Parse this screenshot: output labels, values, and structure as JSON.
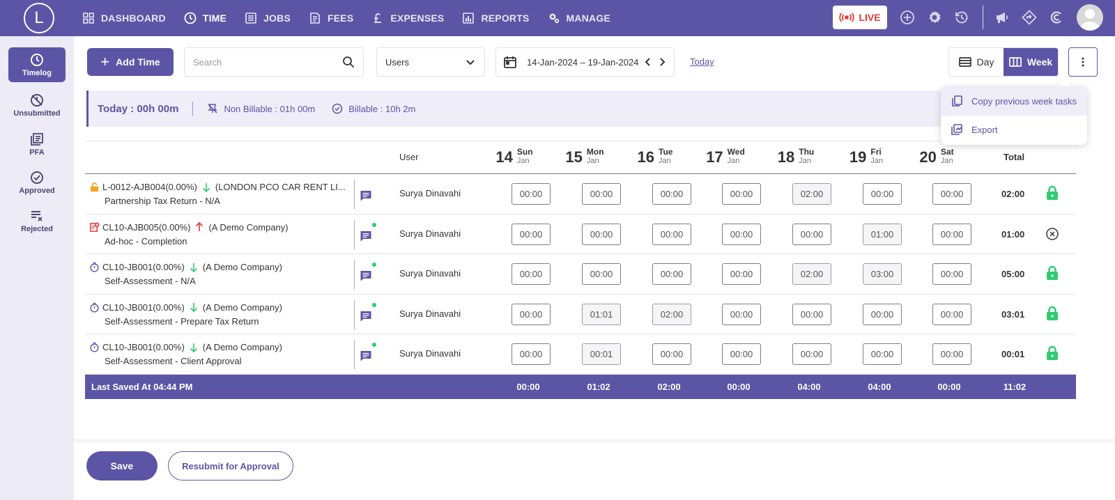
{
  "app": {
    "logo_letter": "L"
  },
  "nav": [
    {
      "label": "DASHBOARD",
      "icon": "grid-icon"
    },
    {
      "label": "TIME",
      "icon": "clock-icon"
    },
    {
      "label": "JOBS",
      "icon": "list-icon"
    },
    {
      "label": "FEES",
      "icon": "document-icon"
    },
    {
      "label": "EXPENSES",
      "icon": "pound-icon"
    },
    {
      "label": "REPORTS",
      "icon": "chart-icon"
    },
    {
      "label": "MANAGE",
      "icon": "gears-icon"
    }
  ],
  "top_actions": {
    "live_label": "LIVE"
  },
  "sidebar": [
    {
      "label": "Timelog",
      "icon": "clock-icon"
    },
    {
      "label": "Unsubmitted",
      "icon": "unsubmitted-icon"
    },
    {
      "label": "PFA",
      "icon": "stack-icon"
    },
    {
      "label": "Approved",
      "icon": "check-circle-icon"
    },
    {
      "label": "Rejected",
      "icon": "reject-list-icon"
    }
  ],
  "toolbar": {
    "add_time_label": "Add Time",
    "search_placeholder": "Search",
    "users_select": "Users",
    "date_range": "14-Jan-2024  –  19-Jan-2024",
    "today_link": "Today",
    "view_day": "Day",
    "view_week": "Week"
  },
  "summary": {
    "today": "Today : 00h 00m",
    "non_billable": "Non Billable : 01h 00m",
    "billable": "Billable : 10h 2m"
  },
  "menu": {
    "copy_label": "Copy previous week tasks",
    "export_label": "Export"
  },
  "table": {
    "user_header": "User",
    "total_header": "Total",
    "days": [
      {
        "num": "14",
        "name": "Sun",
        "month": "Jan"
      },
      {
        "num": "15",
        "name": "Mon",
        "month": "Jan"
      },
      {
        "num": "16",
        "name": "Tue",
        "month": "Jan"
      },
      {
        "num": "17",
        "name": "Wed",
        "month": "Jan"
      },
      {
        "num": "18",
        "name": "Thu",
        "month": "Jan"
      },
      {
        "num": "19",
        "name": "Fri",
        "month": "Jan"
      },
      {
        "num": "20",
        "name": "Sat",
        "month": "Jan"
      }
    ],
    "rows": [
      {
        "code": "L-0012-AJB004(0.00%)",
        "direction": "down",
        "company": "(LONDON PCO CAR RENT LI...",
        "task": "Partnership Tax Return - N/A",
        "user": "Surya Dinavahi",
        "times": [
          "00:00",
          "00:00",
          "00:00",
          "00:00",
          "02:00",
          "00:00",
          "00:00"
        ],
        "total": "02:00",
        "status": "locked",
        "row_icon": "lock-open-icon"
      },
      {
        "code": "CL10-AJB005(0.00%)",
        "direction": "up",
        "company": "(A Demo Company)",
        "task": "Ad-hoc - Completion",
        "user": "Surya Dinavahi",
        "times": [
          "00:00",
          "00:00",
          "00:00",
          "00:00",
          "00:00",
          "01:00",
          "00:00"
        ],
        "total": "01:00",
        "status": "rejected",
        "row_icon": "rejected-doc-icon"
      },
      {
        "code": "CL10-JB001(0.00%)",
        "direction": "down",
        "company": "(A Demo Company)",
        "task": "Self-Assessment - N/A",
        "user": "Surya Dinavahi",
        "times": [
          "00:00",
          "00:00",
          "00:00",
          "00:00",
          "02:00",
          "03:00",
          "00:00"
        ],
        "total": "05:00",
        "status": "locked",
        "row_icon": "timer-icon"
      },
      {
        "code": "CL10-JB001(0.00%)",
        "direction": "down",
        "company": "(A Demo Company)",
        "task": "Self-Assessment - Prepare Tax Return",
        "user": "Surya Dinavahi",
        "times": [
          "00:00",
          "01:01",
          "02:00",
          "00:00",
          "00:00",
          "00:00",
          "00:00"
        ],
        "total": "03:01",
        "status": "locked",
        "row_icon": "timer-icon"
      },
      {
        "code": "CL10-JB001(0.00%)",
        "direction": "down",
        "company": "(A Demo Company)",
        "task": "Self-Assessment - Client Approval",
        "user": "Surya Dinavahi",
        "times": [
          "00:00",
          "00:01",
          "00:00",
          "00:00",
          "00:00",
          "00:00",
          "00:00"
        ],
        "total": "00:01",
        "status": "locked",
        "row_icon": "timer-icon"
      }
    ],
    "footer": {
      "label": "Last Saved At 04:44 PM",
      "totals": [
        "00:00",
        "01:02",
        "02:00",
        "00:00",
        "04:00",
        "04:00",
        "00:00"
      ],
      "grand_total": "11:02"
    }
  },
  "actions": {
    "save_label": "Save",
    "resubmit_label": "Resubmit for Approval"
  },
  "colors": {
    "primary": "#5c55a6",
    "live": "#e53935",
    "success": "#2ecc71",
    "danger": "#e53935"
  }
}
